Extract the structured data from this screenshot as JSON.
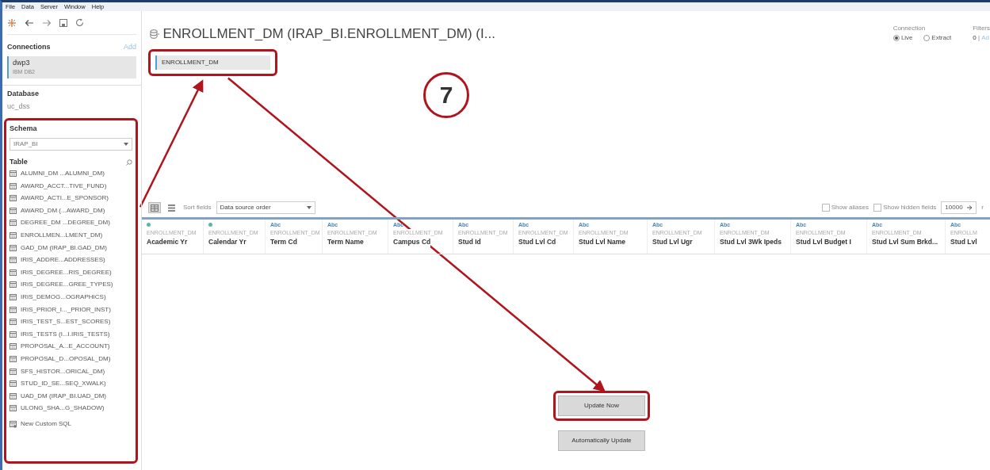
{
  "menu": [
    "File",
    "Data",
    "Server",
    "Window",
    "Help"
  ],
  "sidebar": {
    "connections_label": "Connections",
    "add_label": "Add",
    "connection": {
      "name": "dwp3",
      "type": "IBM DB2",
      "selected": true
    },
    "database_label": "Database",
    "database": "uc_dss",
    "schema_highlighted": true,
    "schema_label": "Schema",
    "schema": "IRAP_BI",
    "table_label": "Table",
    "tables": [
      "ALUMNI_DM ...ALUMNI_DM)",
      "AWARD_ACCT...TIVE_FUND)",
      "AWARD_ACTI...E_SPONSOR)",
      "AWARD_DM (...AWARD_DM)",
      "DEGREE_DM ...DEGREE_DM)",
      "ENROLLMEN...LMENT_DM)",
      "GAD_DM (IRAP_BI.GAD_DM)",
      "IRIS_ADDRE...ADDRESSES)",
      "IRIS_DEGREE...RIS_DEGREE)",
      "IRIS_DEGREE...GREE_TYPES)",
      "IRIS_DEMOG...OGRAPHICS)",
      "IRIS_PRIOR_I..._PRIOR_INST)",
      "IRIS_TEST_S...EST_SCORES)",
      "IRIS_TESTS (I...I.IRIS_TESTS)",
      "PROPOSAL_A...E_ACCOUNT)",
      "PROPOSAL_D...OPOSAL_DM)",
      "SFS_HISTOR...ORICAL_DM)",
      "STUD_ID_SE...SEQ_XWALK)",
      "UAD_DM (IRAP_BI.UAD_DM)",
      "ULONG_SHA...G_SHADOW)"
    ],
    "custom_sql": "New Custom SQL"
  },
  "header": {
    "title": "ENROLLMENT_DM (IRAP_BI.ENROLLMENT_DM) (I...",
    "connection_label": "Connection",
    "connection_modes": [
      {
        "label": "Live",
        "selected": true
      },
      {
        "label": "Extract",
        "selected": false
      }
    ],
    "filters_label": "Filters",
    "filters_count": "0",
    "filters_separator": "|",
    "filters_add": "Ad"
  },
  "canvas": {
    "tables": [
      {
        "name": "ENROLLMENT_DM",
        "highlighted": true
      }
    ]
  },
  "annotation": {
    "step": "7"
  },
  "grid": {
    "view_modes": [
      {
        "kind": "grid",
        "selected": true
      },
      {
        "kind": "list",
        "selected": false
      }
    ],
    "sort_label": "Sort fields",
    "sort_value": "Data source order",
    "show_aliases": {
      "label": "Show aliases",
      "checked": false
    },
    "show_hidden": {
      "label": "Show hidden fields",
      "checked": false
    },
    "rows": "10000",
    "rows_label": "r",
    "columns": [
      {
        "kind": "number",
        "source": "ENROLLMENT_DM",
        "name": "Academic Yr"
      },
      {
        "kind": "number",
        "source": "ENROLLMENT_DM",
        "name": "Calendar Yr"
      },
      {
        "kind": "string",
        "type_label": "Abc",
        "source": "ENROLLMENT_DM",
        "name": "Term Cd"
      },
      {
        "kind": "string",
        "type_label": "Abc",
        "source": "ENROLLMENT_DM",
        "name": "Term Name"
      },
      {
        "kind": "string",
        "type_label": "Abc",
        "source": "ENROLLMENT_DM",
        "name": "Campus Cd"
      },
      {
        "kind": "string",
        "type_label": "Abc",
        "source": "ENROLLMENT_DM",
        "name": "Stud Id"
      },
      {
        "kind": "string",
        "type_label": "Abc",
        "source": "ENROLLMENT_DM",
        "name": "Stud Lvl Cd"
      },
      {
        "kind": "string",
        "type_label": "Abc",
        "source": "ENROLLMENT_DM",
        "name": "Stud Lvl Name"
      },
      {
        "kind": "string",
        "type_label": "Abc",
        "source": "ENROLLMENT_DM",
        "name": "Stud Lvl Ugr"
      },
      {
        "kind": "string",
        "type_label": "Abc",
        "source": "ENROLLMENT_DM",
        "name": "Stud Lvl 3Wk Ipeds"
      },
      {
        "kind": "string",
        "type_label": "Abc",
        "source": "ENROLLMENT_DM",
        "name": "Stud Lvl Budget I"
      },
      {
        "kind": "string",
        "type_label": "Abc",
        "source": "ENROLLMENT_DM",
        "name": "Stud Lvl Sum Brkd..."
      },
      {
        "kind": "string",
        "type_label": "Abc",
        "source": "ENROLLM",
        "name": "Stud Lvl"
      }
    ]
  },
  "update": {
    "buttons": [
      {
        "label": "Update Now",
        "highlighted": true
      },
      {
        "label": "Automatically Update",
        "highlighted": false
      }
    ]
  }
}
